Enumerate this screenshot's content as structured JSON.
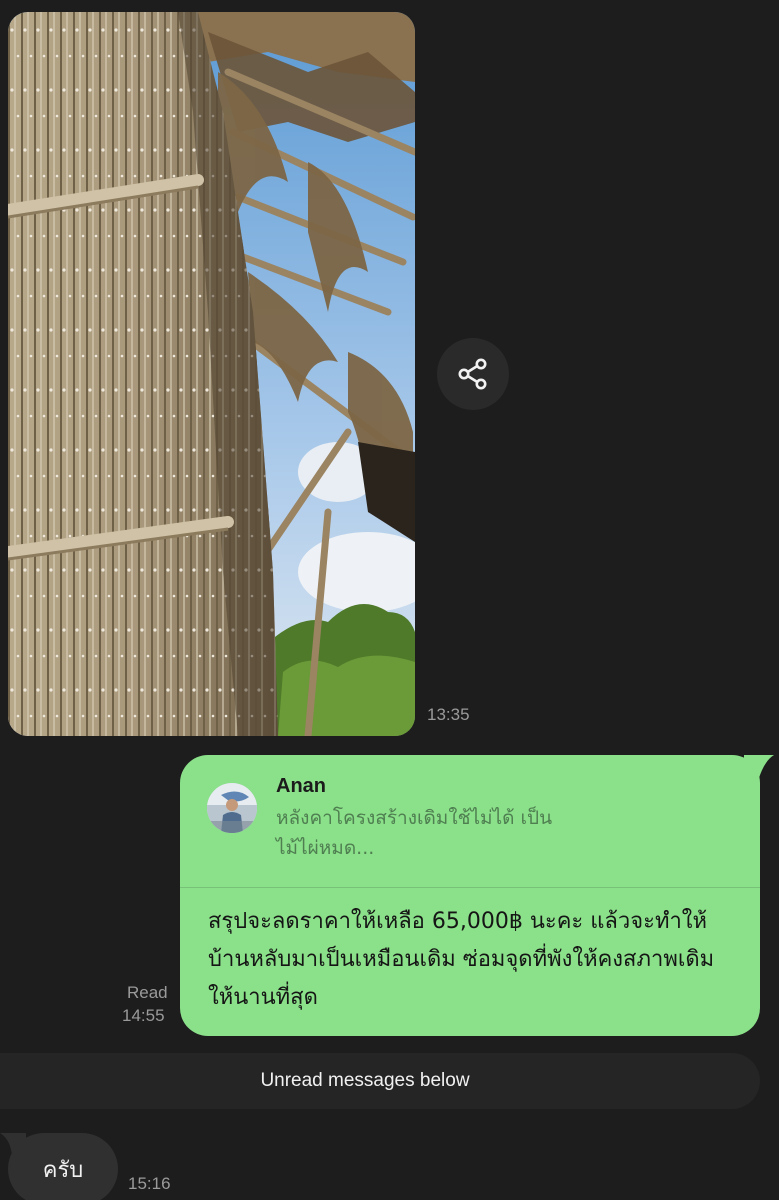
{
  "messages": {
    "photo": {
      "time": "13:35"
    },
    "reply": {
      "quote_author": "Anan",
      "quote_text": "หลังคาโครงสร้างเดิมใช้ไม่ได้ เป็นไม้ไผ่หมด...",
      "text": "สรุปจะลดราคาให้เหลือ 65,000฿ นะคะ แล้วจะทำให้บ้านหลับมาเป็นเหมือนเดิม ซ่อมจุดที่พังให้คงสภาพเดิมให้นานที่สุด",
      "read_status": "Read",
      "time": "14:55",
      "bubble_color": "#8be08a"
    },
    "unread_divider": "Unread messages below",
    "incoming": {
      "text": "ครับ",
      "time": "15:16"
    }
  },
  "icons": {
    "share": "share-icon"
  },
  "colors": {
    "background": "#1d1d1d",
    "sent_bubble": "#8be08a",
    "received_bubble": "#303030",
    "timestamp": "#9a9a9a"
  }
}
